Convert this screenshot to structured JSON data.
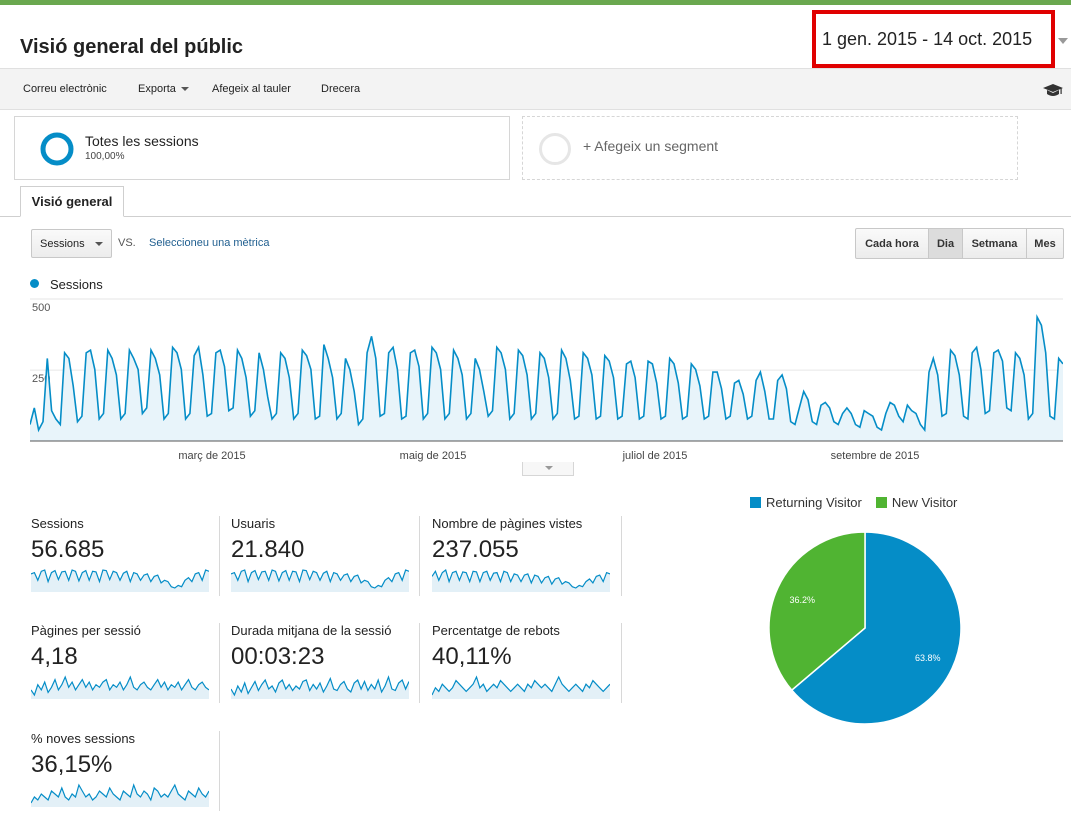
{
  "header": {
    "title": "Visió general del públic",
    "date_range": "1 gen. 2015 - 14 oct. 2015"
  },
  "toolbar": {
    "email": "Correu electrònic",
    "export": "Exporta",
    "add_dashboard": "Afegeix al tauler",
    "shortcut": "Drecera"
  },
  "segments": {
    "active_name": "Totes les sessions",
    "active_pct": "100,00%",
    "add_label": "+ Afegeix un segment"
  },
  "tab": {
    "label": "Visió general"
  },
  "controls": {
    "metric": "Sessions",
    "vs": "VS.",
    "select_metric": "Seleccioneu una mètrica",
    "granularity": [
      "Cada hora",
      "Dia",
      "Setmana",
      "Mes"
    ],
    "active_granularity": "Dia"
  },
  "colors": {
    "primary": "#058dc7",
    "secondary": "#50b432",
    "accent_bar": "#6aa84f",
    "highlight": "#e00000"
  },
  "chart_data": [
    {
      "type": "area",
      "legend": "Sessions",
      "y_ticks": [
        "500",
        "250"
      ],
      "ylim": [
        0,
        500
      ],
      "x_labels": [
        "març de 2015",
        "maig de 2015",
        "juliol de 2015",
        "setembre de 2015"
      ],
      "series": [
        {
          "name": "Sessions",
          "values": [
            60,
            120,
            40,
            70,
            300,
            110,
            80,
            60,
            320,
            300,
            200,
            70,
            90,
            320,
            330,
            260,
            80,
            100,
            330,
            300,
            240,
            80,
            100,
            330,
            300,
            260,
            100,
            120,
            330,
            300,
            240,
            80,
            100,
            340,
            320,
            260,
            80,
            100,
            310,
            340,
            240,
            90,
            100,
            320,
            330,
            270,
            110,
            120,
            330,
            300,
            230,
            90,
            110,
            320,
            260,
            160,
            80,
            100,
            320,
            300,
            230,
            80,
            100,
            330,
            310,
            260,
            80,
            90,
            350,
            300,
            230,
            80,
            100,
            300,
            260,
            180,
            60,
            80,
            320,
            380,
            300,
            90,
            100,
            320,
            340,
            260,
            80,
            90,
            320,
            330,
            270,
            80,
            100,
            340,
            320,
            260,
            80,
            100,
            330,
            300,
            240,
            80,
            100,
            300,
            260,
            180,
            90,
            110,
            340,
            320,
            260,
            80,
            100,
            330,
            310,
            240,
            80,
            100,
            320,
            300,
            230,
            80,
            100,
            330,
            300,
            220,
            80,
            90,
            320,
            300,
            240,
            80,
            90,
            310,
            290,
            230,
            80,
            90,
            280,
            290,
            230,
            80,
            90,
            290,
            280,
            210,
            80,
            90,
            300,
            280,
            210,
            80,
            90,
            280,
            260,
            200,
            80,
            90,
            250,
            250,
            190,
            80,
            90,
            210,
            220,
            170,
            80,
            90,
            220,
            250,
            180,
            80,
            80,
            220,
            240,
            190,
            70,
            60,
            120,
            180,
            150,
            70,
            60,
            130,
            140,
            120,
            70,
            60,
            100,
            120,
            100,
            60,
            50,
            110,
            100,
            90,
            50,
            40,
            100,
            140,
            130,
            90,
            70,
            130,
            110,
            100,
            60,
            40,
            250,
            300,
            240,
            90,
            100,
            330,
            310,
            240,
            90,
            80,
            320,
            340,
            260,
            100,
            110,
            320,
            330,
            290,
            120,
            110,
            320,
            300,
            240,
            80,
            100,
            450,
            420,
            320,
            90,
            80,
            300,
            280
          ]
        }
      ]
    },
    {
      "type": "pie",
      "legend_entries": [
        "Returning Visitor",
        "New Visitor"
      ],
      "slices": [
        {
          "name": "Returning Visitor",
          "value": 63.8,
          "label": "63.8%"
        },
        {
          "name": "New Visitor",
          "value": 36.2,
          "label": "36.2%"
        }
      ]
    }
  ],
  "stats": [
    {
      "label": "Sessions",
      "value": "56.685",
      "spark": [
        40,
        42,
        30,
        44,
        46,
        28,
        42,
        45,
        31,
        43,
        44,
        30,
        46,
        44,
        29,
        42,
        45,
        30,
        44,
        43,
        28,
        46,
        45,
        31,
        44,
        42,
        30,
        41,
        44,
        28,
        42,
        40,
        30,
        38,
        40,
        28,
        36,
        38,
        26,
        30,
        28,
        20,
        18,
        22,
        20,
        30,
        34,
        28,
        40,
        42,
        30,
        46,
        44
      ]
    },
    {
      "label": "Usuaris",
      "value": "21.840",
      "spark": [
        40,
        42,
        30,
        44,
        46,
        28,
        42,
        45,
        31,
        43,
        44,
        30,
        46,
        44,
        29,
        42,
        45,
        30,
        44,
        43,
        28,
        46,
        45,
        31,
        44,
        42,
        30,
        41,
        44,
        28,
        42,
        40,
        30,
        38,
        40,
        28,
        36,
        38,
        26,
        30,
        28,
        20,
        18,
        22,
        20,
        30,
        34,
        28,
        40,
        42,
        30,
        46,
        44
      ]
    },
    {
      "label": "Nombre de pàgines vistes",
      "value": "237.055",
      "spark": [
        38,
        46,
        32,
        44,
        48,
        30,
        44,
        46,
        32,
        45,
        44,
        30,
        46,
        45,
        30,
        44,
        46,
        32,
        43,
        44,
        30,
        46,
        44,
        30,
        42,
        40,
        30,
        40,
        42,
        28,
        40,
        38,
        28,
        36,
        38,
        26,
        34,
        36,
        26,
        30,
        28,
        22,
        20,
        24,
        22,
        30,
        34,
        28,
        38,
        40,
        30,
        44,
        42
      ]
    },
    {
      "label": "Pàgines per sessió",
      "value": "4,18",
      "spark": [
        30,
        28,
        32,
        30,
        33,
        29,
        31,
        34,
        30,
        32,
        35,
        31,
        33,
        30,
        32,
        34,
        31,
        33,
        30,
        32,
        31,
        33,
        34,
        30,
        32,
        31,
        33,
        30,
        32,
        35,
        31,
        30,
        32,
        33,
        31,
        30,
        32,
        34,
        31,
        33,
        30,
        32,
        31,
        33,
        30,
        32,
        34,
        31,
        30,
        32,
        33,
        31,
        30
      ]
    },
    {
      "label": "Durada mitjana de la sessió",
      "value": "00:03:23",
      "spark": [
        30,
        26,
        32,
        28,
        34,
        27,
        31,
        35,
        29,
        33,
        36,
        30,
        32,
        28,
        34,
        36,
        30,
        33,
        29,
        32,
        30,
        35,
        36,
        29,
        33,
        30,
        34,
        28,
        32,
        37,
        30,
        29,
        33,
        35,
        30,
        28,
        34,
        36,
        30,
        35,
        29,
        33,
        30,
        36,
        28,
        32,
        38,
        30,
        29,
        34,
        36,
        30,
        35
      ]
    },
    {
      "label": "Percentatge de rebots",
      "value": "40,11%",
      "spark": [
        28,
        30,
        29,
        31,
        30,
        29,
        30,
        32,
        31,
        30,
        29,
        30,
        31,
        33,
        30,
        31,
        29,
        30,
        31,
        30,
        32,
        31,
        30,
        29,
        30,
        31,
        30,
        29,
        31,
        30,
        32,
        31,
        30,
        31,
        30,
        29,
        31,
        33,
        31,
        30,
        29,
        30,
        31,
        30,
        29,
        31,
        30,
        32,
        31,
        30,
        29,
        30,
        31
      ]
    },
    {
      "label": "% noves sessions",
      "value": "36,15%",
      "spark": [
        28,
        30,
        29,
        31,
        30,
        29,
        32,
        31,
        30,
        33,
        30,
        29,
        31,
        30,
        34,
        32,
        30,
        31,
        29,
        30,
        32,
        31,
        30,
        33,
        31,
        30,
        29,
        32,
        31,
        30,
        34,
        31,
        30,
        32,
        31,
        29,
        33,
        32,
        30,
        31,
        30,
        32,
        34,
        31,
        30,
        29,
        32,
        31,
        30,
        33,
        31,
        30,
        32
      ]
    }
  ]
}
